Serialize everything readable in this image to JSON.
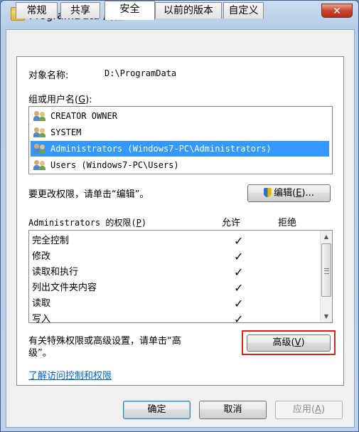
{
  "window": {
    "title": "ProgramData 属性",
    "close_label": "✕"
  },
  "tabs": [
    {
      "label": "常规"
    },
    {
      "label": "共享"
    },
    {
      "label": "安全"
    },
    {
      "label": "以前的版本"
    },
    {
      "label": "自定义"
    }
  ],
  "security": {
    "object_label": "对象名称:",
    "object_value": "D:\\ProgramData",
    "group_label": "组或用户名",
    "group_hotkey": "G",
    "group_suffix": "):",
    "group_prefix": "(",
    "users": [
      {
        "name": "CREATOR OWNER"
      },
      {
        "name": "SYSTEM"
      },
      {
        "name": "Administrators (Windows7-PC\\Administrators)"
      },
      {
        "name": "Users (Windows7-PC\\Users)"
      }
    ],
    "edit_hint": "要更改权限，请单击“编辑”。",
    "edit_button": "编辑",
    "edit_hotkey": "E",
    "edit_suffix": "...",
    "perm_title": "Administrators 的权限",
    "perm_hotkey": "P",
    "allow_header": "允许",
    "deny_header": "拒绝",
    "permissions": [
      {
        "name": "完全控制",
        "allow": "✓"
      },
      {
        "name": "修改",
        "allow": "✓"
      },
      {
        "name": "读取和执行",
        "allow": "✓"
      },
      {
        "name": "列出文件夹内容",
        "allow": "✓"
      },
      {
        "name": "读取",
        "allow": "✓"
      },
      {
        "name": "写入",
        "allow": "✓"
      }
    ],
    "advanced_hint_line1": "有关特殊权限或高级设置，请单击“高",
    "advanced_hint_line2": "级”。",
    "advanced_button": "高级",
    "advanced_hotkey": "V",
    "learn_link": "了解访问控制和权限"
  },
  "footer": {
    "ok": "确定",
    "cancel": "取消",
    "apply": "应用",
    "apply_hotkey": "A"
  },
  "colors": {
    "selection": "#3399ff",
    "highlight_box": "#e0201b",
    "link": "#0066cc"
  }
}
